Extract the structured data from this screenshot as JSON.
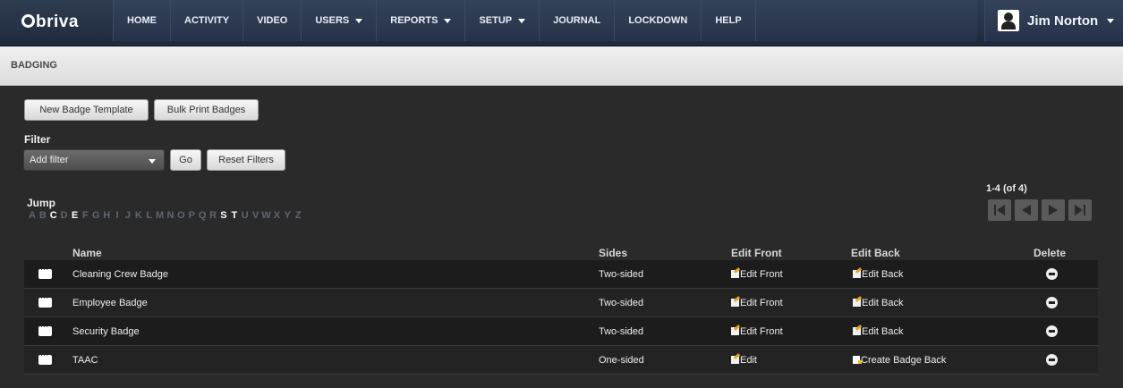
{
  "nav": {
    "logo": "briva",
    "items": [
      "HOME",
      "ACTIVITY",
      "VIDEO",
      "USERS",
      "REPORTS",
      "SETUP",
      "JOURNAL",
      "LOCKDOWN",
      "HELP"
    ],
    "user_name": "Jim Norton"
  },
  "page": {
    "title": "BADGING"
  },
  "toolbar": {
    "new_template": "New Badge Template",
    "bulk_print": "Bulk Print Badges"
  },
  "filter": {
    "label": "Filter",
    "select_value": "Add filter",
    "go": "Go",
    "reset": "Reset Filters"
  },
  "jump": {
    "label": "Jump",
    "letters": [
      "A",
      "B",
      "C",
      "D",
      "E",
      "F",
      "G",
      "H",
      "I",
      "J",
      "K",
      "L",
      "M",
      "N",
      "O",
      "P",
      "Q",
      "R",
      "S",
      "T",
      "U",
      "V",
      "W",
      "X",
      "Y",
      "Z"
    ],
    "active": [
      "C",
      "E",
      "S",
      "T"
    ]
  },
  "pagination": {
    "summary": "1-4 (of 4)"
  },
  "table": {
    "headers": {
      "name": "Name",
      "sides": "Sides",
      "edit_front": "Edit Front",
      "edit_back": "Edit Back",
      "delete": "Delete"
    },
    "rows": [
      {
        "name": "Cleaning Crew Badge",
        "sides": "Two-sided",
        "front": "Edit Front",
        "back": "Edit Back"
      },
      {
        "name": "Employee Badge",
        "sides": "Two-sided",
        "front": "Edit Front",
        "back": "Edit Back"
      },
      {
        "name": "Security Badge",
        "sides": "Two-sided",
        "front": "Edit Front",
        "back": "Edit Back"
      },
      {
        "name": "TAAC",
        "sides": "One-sided",
        "front": "Edit",
        "back": "Create Badge Back"
      }
    ]
  },
  "icons": {
    "badge": "badge-card-icon",
    "edit": "edit-pencil-icon",
    "new": "new-document-icon",
    "delete": "minus-circle-icon",
    "avatar": "user-avatar-icon",
    "paging": [
      "first-page-icon",
      "prev-page-icon",
      "next-page-icon",
      "last-page-icon"
    ]
  },
  "colors": {
    "nav_bg": "#26324a",
    "content_bg": "#2a2a2a",
    "accent": "#e9a21a"
  }
}
